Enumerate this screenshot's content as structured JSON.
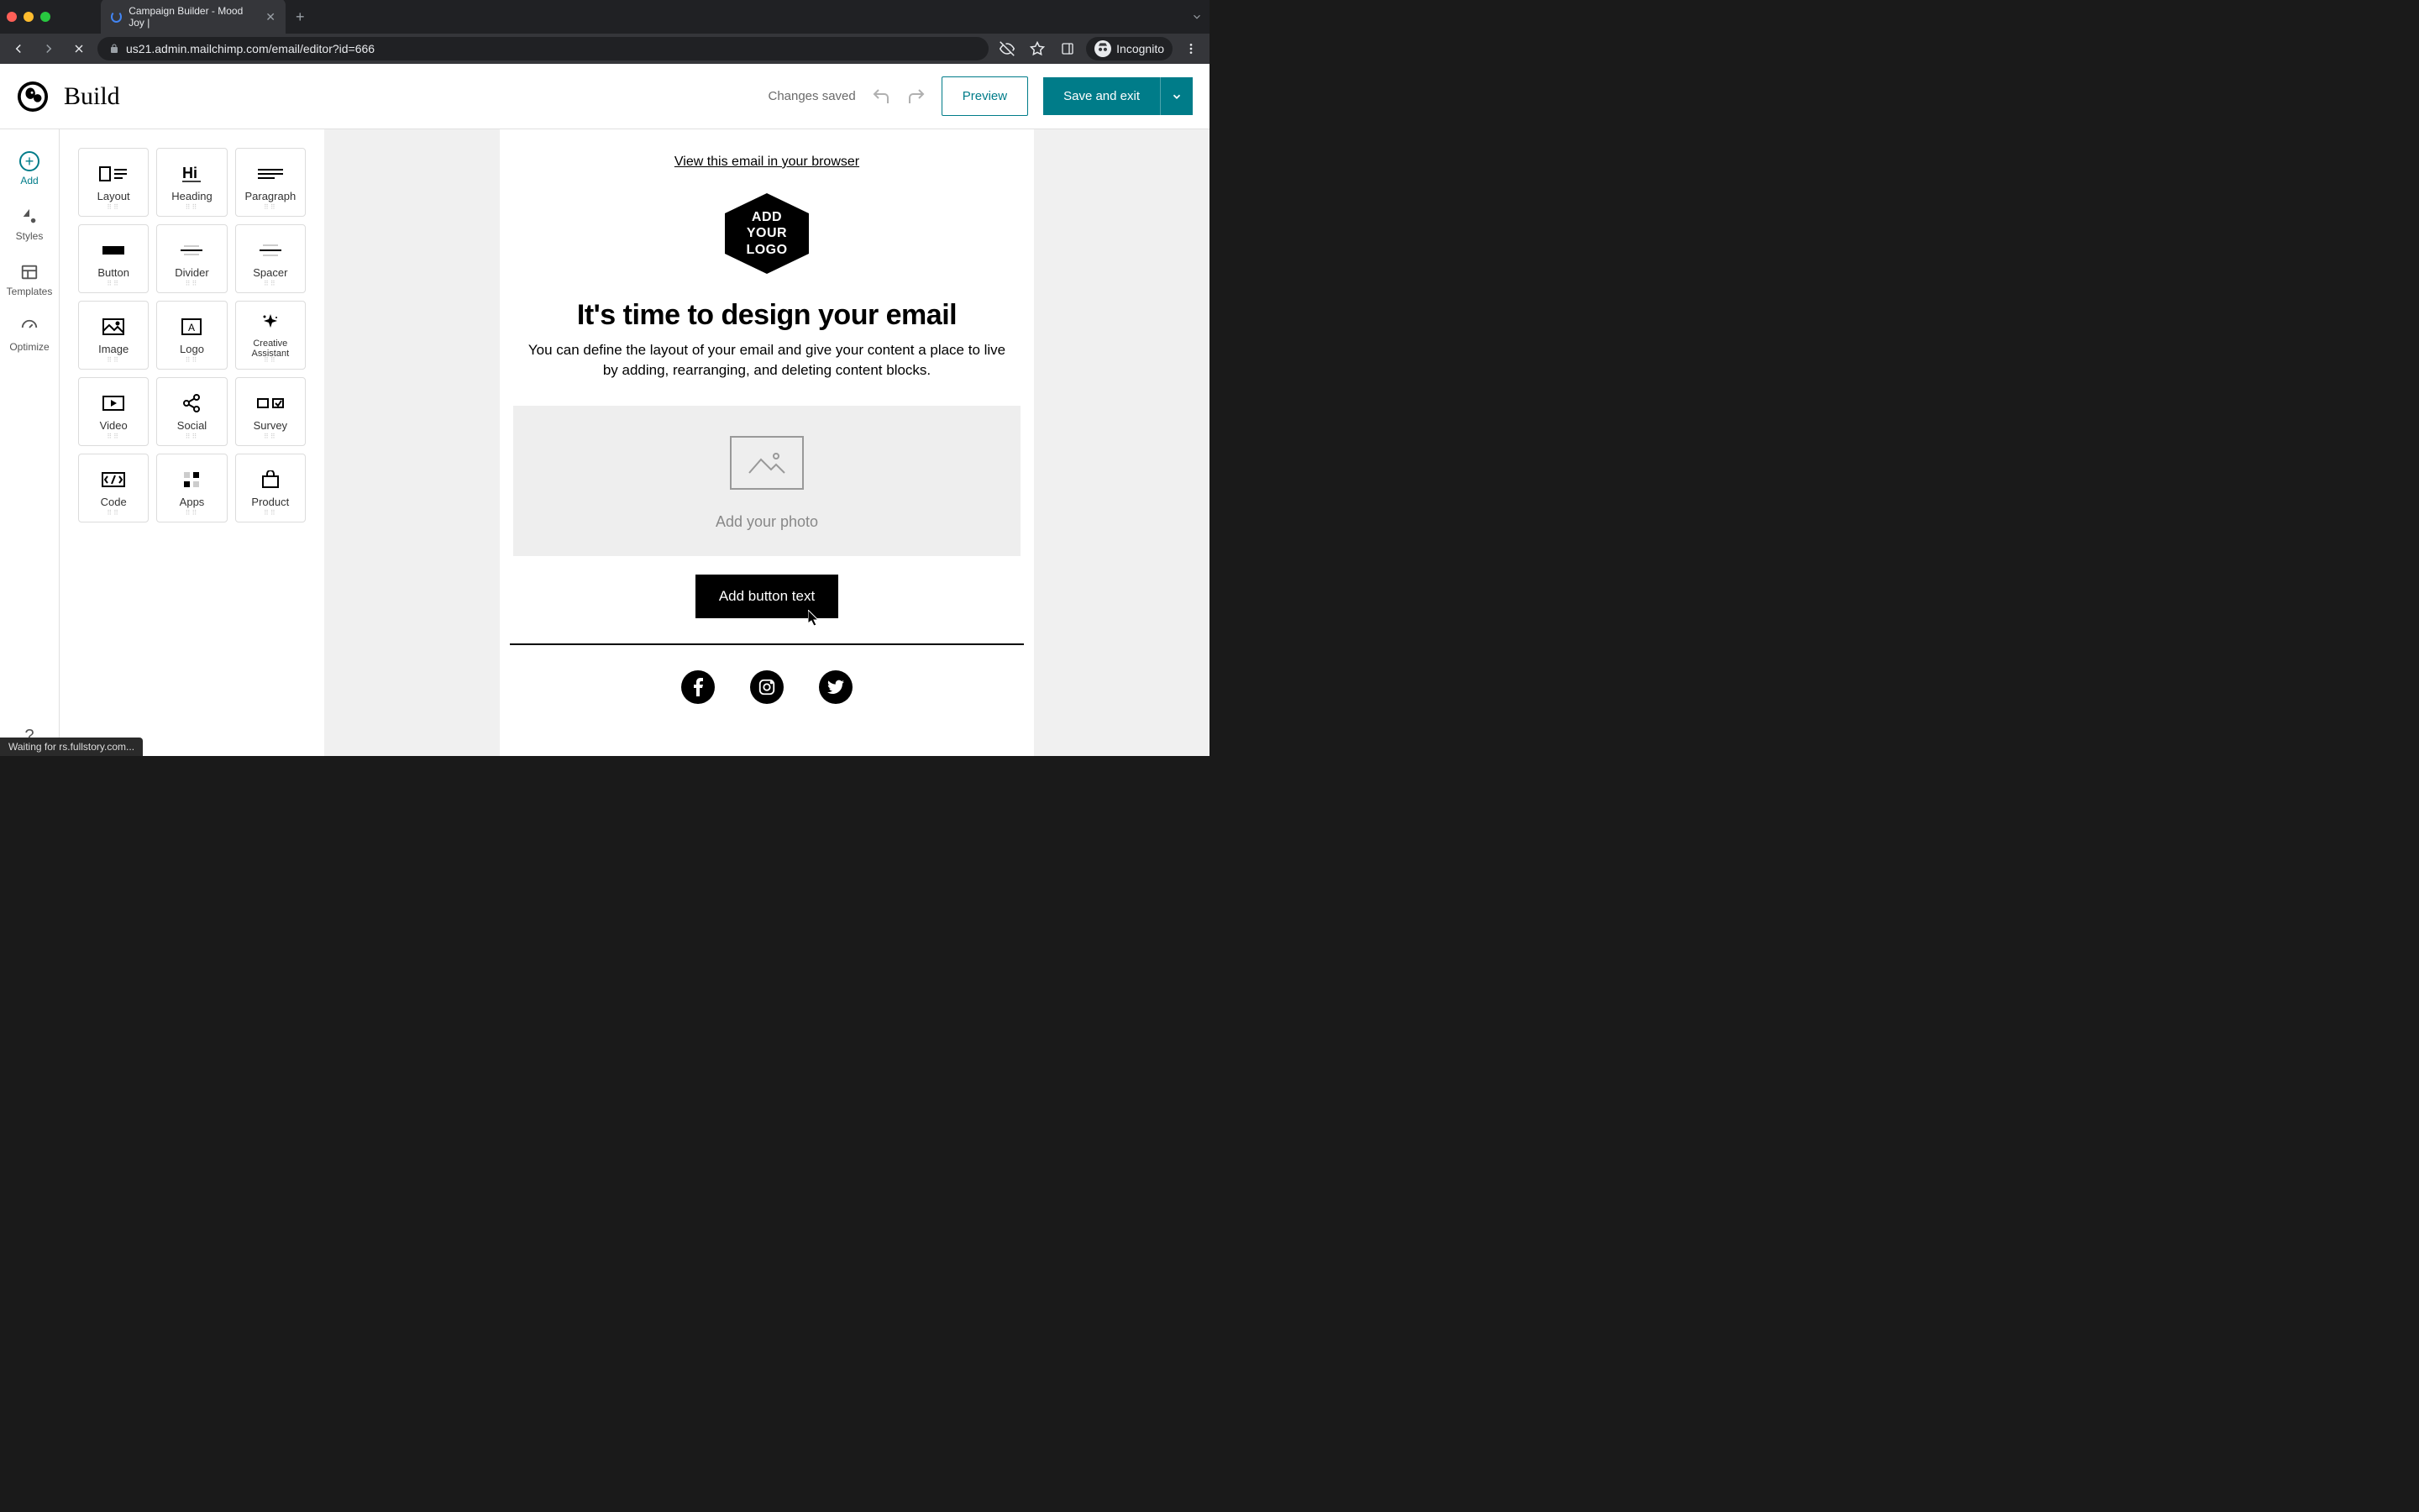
{
  "browser": {
    "tab_title": "Campaign Builder - Mood Joy |",
    "url": "us21.admin.mailchimp.com/email/editor?id=666",
    "incognito_label": "Incognito"
  },
  "header": {
    "title": "Build",
    "status": "Changes saved",
    "preview_label": "Preview",
    "save_label": "Save and exit"
  },
  "rail": {
    "items": [
      {
        "id": "add",
        "label": "Add"
      },
      {
        "id": "styles",
        "label": "Styles"
      },
      {
        "id": "templates",
        "label": "Templates"
      },
      {
        "id": "optimize",
        "label": "Optimize"
      }
    ],
    "help": "?"
  },
  "blocks": [
    {
      "id": "layout",
      "label": "Layout"
    },
    {
      "id": "heading",
      "label": "Heading"
    },
    {
      "id": "paragraph",
      "label": "Paragraph"
    },
    {
      "id": "button",
      "label": "Button"
    },
    {
      "id": "divider",
      "label": "Divider"
    },
    {
      "id": "spacer",
      "label": "Spacer"
    },
    {
      "id": "image",
      "label": "Image"
    },
    {
      "id": "logo",
      "label": "Logo"
    },
    {
      "id": "creative",
      "label": "Creative Assistant"
    },
    {
      "id": "video",
      "label": "Video"
    },
    {
      "id": "social",
      "label": "Social"
    },
    {
      "id": "survey",
      "label": "Survey"
    },
    {
      "id": "code",
      "label": "Code"
    },
    {
      "id": "apps",
      "label": "Apps"
    },
    {
      "id": "product",
      "label": "Product"
    }
  ],
  "canvas": {
    "view_link": "View this email in your browser",
    "logo_line1": "ADD",
    "logo_line2": "YOUR",
    "logo_line3": "LOGO",
    "heading": "It's time to design your email",
    "paragraph": "You can define the layout of your email and give your content a place to live by adding, rearranging, and deleting content blocks.",
    "photo_caption": "Add your photo",
    "button_label": "Add button text",
    "socials": [
      "facebook",
      "instagram",
      "twitter"
    ]
  },
  "status_bar": "Waiting for rs.fullstory.com...",
  "colors": {
    "accent": "#007c89",
    "canvas_bg": "#f0f0f0"
  }
}
